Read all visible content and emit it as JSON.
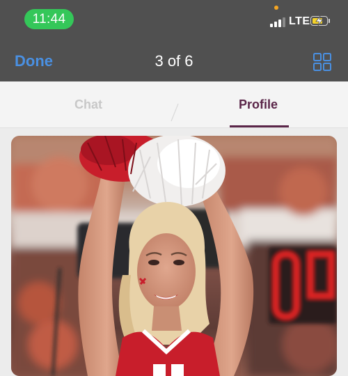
{
  "status_bar": {
    "time": "11:44",
    "network": "LTE",
    "colors": {
      "time_pill": "#34c759",
      "battery": "#f5d32a",
      "dot": "#f5a623"
    }
  },
  "nav": {
    "done_label": "Done",
    "title": "3 of 6",
    "grid_icon": "grid-view-icon",
    "accent": "#4a90e2"
  },
  "tabs": [
    {
      "label": "Chat",
      "active": false
    },
    {
      "label": "Profile",
      "active": true
    }
  ],
  "tab_accent": "#5a2548",
  "photo": {
    "description_icon": "profile-photo"
  }
}
